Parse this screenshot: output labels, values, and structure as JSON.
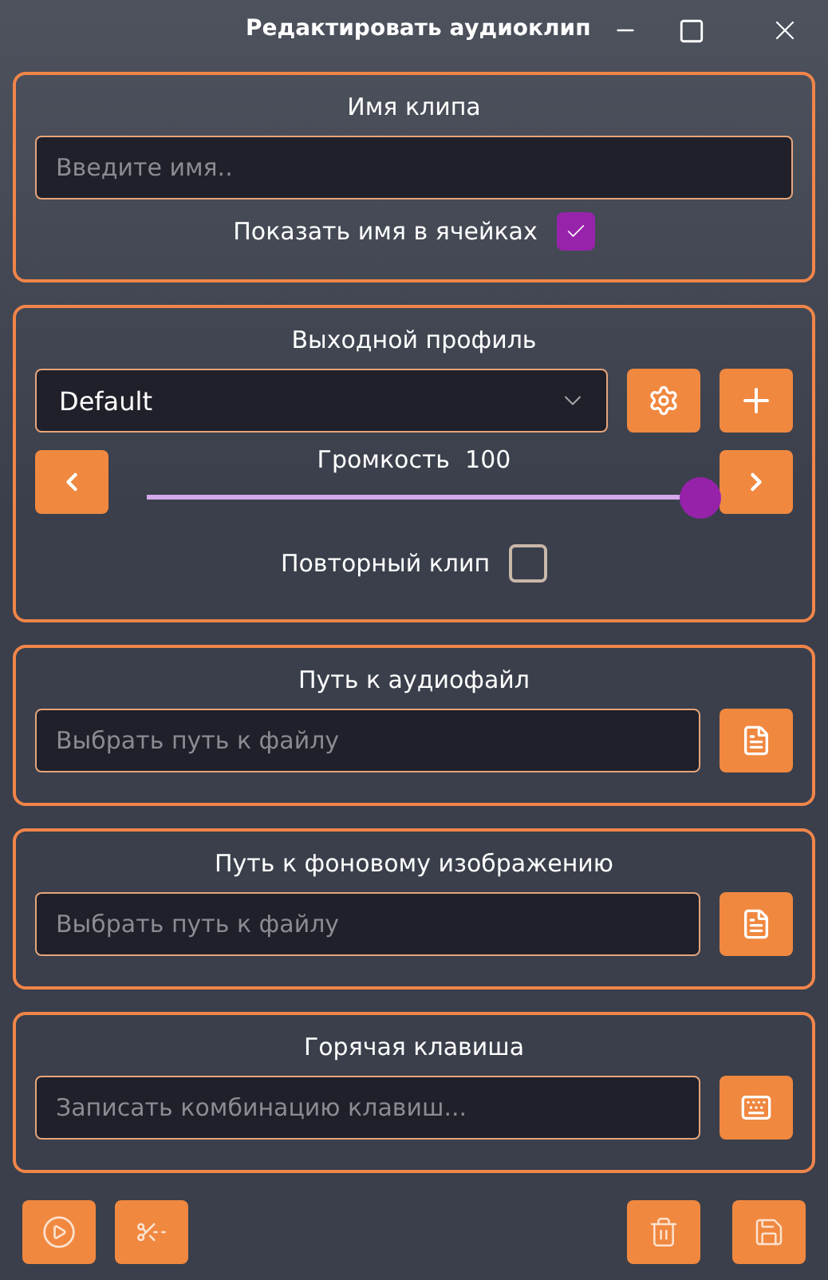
{
  "window": {
    "title": "Редактировать аудиоклип"
  },
  "name_section": {
    "title": "Имя клипа",
    "field": {
      "placeholder": "Введите имя.."
    },
    "show_name": {
      "label": "Показать имя в ячейках",
      "checked": true
    }
  },
  "profile_section": {
    "title": "Выходной профиль",
    "profile": {
      "value": "Default"
    },
    "volume": {
      "label": "Громкость",
      "value": "100",
      "level": 1
    },
    "repeat": {
      "label": "Повторный клип",
      "checked": false
    }
  },
  "path_sections": [
    {
      "kind": "file",
      "title": "Путь к аудиофайл",
      "placeholder": "Выбрать путь к файлу"
    },
    {
      "kind": "file",
      "title": "Путь к фоновому изображению",
      "placeholder": "Выбрать путь к файлу"
    },
    {
      "kind": "hotkey",
      "title": "Горячая клавиша",
      "placeholder": "Записать комбинацию клавиш..."
    }
  ]
}
